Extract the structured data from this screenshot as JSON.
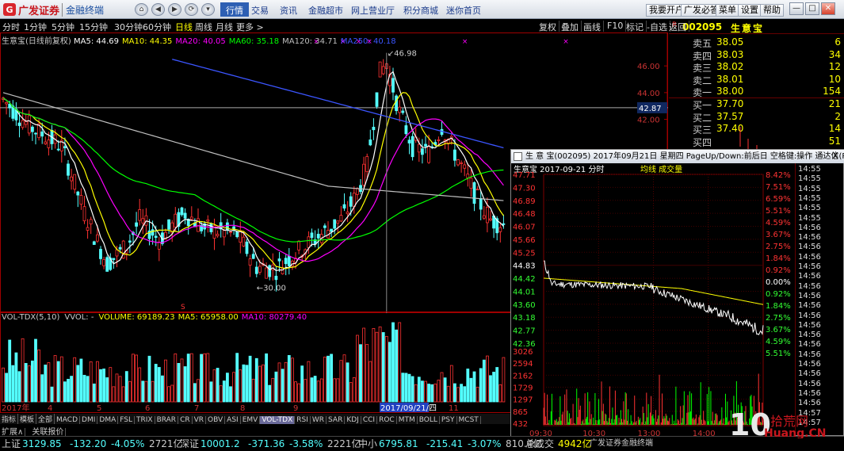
{
  "app": {
    "brand": "广发证券",
    "subtitle": "金融终端",
    "main_nav": [
      "行情",
      "交易",
      "资讯",
      "金融超市",
      "网上营业厅",
      "积分商城",
      "迷你首页"
    ],
    "active_nav": "行情",
    "right_buttons": [
      "我要开户",
      "广发必答",
      "菜单",
      "设置",
      "帮助"
    ]
  },
  "periods": {
    "items": [
      "分时",
      "1分钟",
      "5分钟",
      "15分钟",
      "30分钟",
      "60分钟",
      "日线",
      "周线",
      "月线",
      "更多 >"
    ],
    "active": "日线"
  },
  "tools": [
    "复权",
    "叠加",
    "画线",
    "F10",
    "标记",
    "-自选",
    "返回"
  ],
  "stock": {
    "code": "002095",
    "name": "生意宝",
    "code_marker": "R"
  },
  "chart_data": [
    {
      "type": "candlestick",
      "title": "生意宝(日线前复权)",
      "indicators": [
        {
          "name": "MA5",
          "value": "44.69",
          "color": "#ffffff"
        },
        {
          "name": "MA10",
          "value": "44.35",
          "color": "#ffff00"
        },
        {
          "name": "MA20",
          "value": "40.05",
          "color": "#ff00ff"
        },
        {
          "name": "MA60",
          "value": "35.18",
          "color": "#00ff00"
        },
        {
          "name": "MA120",
          "value": "34.71",
          "color": "#c0c0c0"
        },
        {
          "name": "MA250",
          "value": "40.18",
          "color": "#3b55ff"
        }
      ],
      "yticks": [
        "46.00",
        "44.00",
        "42.00"
      ],
      "cursor_price": "42.87",
      "high_label": "46.98",
      "low_label": "30.00",
      "xlabels": [
        "2017年",
        "4",
        "5",
        "6",
        "7",
        "8",
        "9",
        "2017/09/21/四",
        "11"
      ],
      "ylim": [
        27.5,
        48.5
      ]
    },
    {
      "type": "bar",
      "title": "VOL-TDX(5,10)",
      "sub": "VVOL: -",
      "indicators": [
        {
          "name": "VOLUME",
          "value": "69189.23",
          "color": "#ffff00"
        },
        {
          "name": "MA5",
          "value": "65958.00",
          "color": "#ffff00"
        },
        {
          "name": "MA10",
          "value": "80279.40",
          "color": "#ff00ff"
        }
      ]
    },
    {
      "type": "line",
      "title": "生意宝 2017-09-21 分时",
      "subtitle": "均线 成交量",
      "y_prices": [
        "47.71",
        "47.30",
        "46.89",
        "46.48",
        "46.07",
        "45.66",
        "45.25",
        "44.83",
        "44.42",
        "44.01",
        "43.60",
        "43.18",
        "42.77",
        "42.36"
      ],
      "y_pcts": [
        "8.42%",
        "7.51%",
        "6.59%",
        "5.51%",
        "4.59%",
        "3.67%",
        "2.75%",
        "1.84%",
        "0.92%",
        "0.00%",
        "0.92%",
        "1.84%",
        "2.75%",
        "3.67%",
        "4.59%",
        "5.51%"
      ],
      "vol_ticks": [
        "3026",
        "2594",
        "2162",
        "1729",
        "1297",
        "865",
        "432"
      ],
      "x_labels": [
        "09:30",
        "10:30",
        "13:00",
        "14:00"
      ],
      "ylim": [
        41.9,
        48.0
      ]
    }
  ],
  "index_tabs": [
    "指标",
    "模板",
    "全部",
    "MACD",
    "DMI",
    "DMA",
    "FSL",
    "TRIX",
    "BRAR",
    "CR",
    "VR",
    "OBV",
    "ASI",
    "EMV",
    "VOL-TDX",
    "RSI",
    "WR",
    "SAR",
    "KDJ",
    "CCI",
    "ROC",
    "MTM",
    "BOLL",
    "PSY",
    "MCST"
  ],
  "bottom_tabs": [
    "扩展∧",
    "关联报价"
  ],
  "quote": {
    "asks": [
      {
        "label": "卖五",
        "price": "38.05",
        "vol": "6"
      },
      {
        "label": "卖四",
        "price": "38.03",
        "vol": "34"
      },
      {
        "label": "卖三",
        "price": "38.02",
        "vol": "12"
      },
      {
        "label": "卖二",
        "price": "38.01",
        "vol": "10"
      },
      {
        "label": "卖一",
        "price": "38.00",
        "vol": "154"
      }
    ],
    "bids": [
      {
        "label": "买一",
        "price": "37.70",
        "vol": "21"
      },
      {
        "label": "买二",
        "price": "37.57",
        "vol": "2"
      },
      {
        "label": "买三",
        "price": "37.40",
        "vol": "14"
      },
      {
        "label": "买四",
        "price": "",
        "vol": "51"
      }
    ]
  },
  "popup": {
    "window_title": "生 意 宝(002095)  2017年09月21日 星期四 PageUp/Down:前后日 空格键:操作 通达信(R)",
    "close": "X"
  },
  "trades": [
    "14:55",
    "14:55",
    "14:55",
    "14:55",
    "14:55",
    "14:55",
    "14:56",
    "14:56",
    "14:56",
    "14:56",
    "14:56",
    "14:56",
    "14:56",
    "14:56",
    "14:56",
    "14:56",
    "14:56",
    "14:56",
    "14:56",
    "14:56",
    "14:56",
    "14:56",
    "14:56",
    "14:56",
    "14:56",
    "14:57",
    "14:57"
  ],
  "status": {
    "items": [
      {
        "label": "上证",
        "value": "3129.85",
        "chg": "-132.20",
        "pct": "-4.05%",
        "amt": "2721亿"
      },
      {
        "label": "深证",
        "value": "10001.2",
        "chg": "-371.36",
        "pct": "-3.58%",
        "amt": "2221亿"
      },
      {
        "label": "中小",
        "value": "6795.81",
        "chg": "-215.41",
        "pct": "-3.07%",
        "amt": "810.4亿"
      }
    ],
    "total_label": "总成交",
    "total": "4942亿",
    "broker": "广发证券金融终端"
  },
  "watermark": "10Huang.CN 拾荒网"
}
